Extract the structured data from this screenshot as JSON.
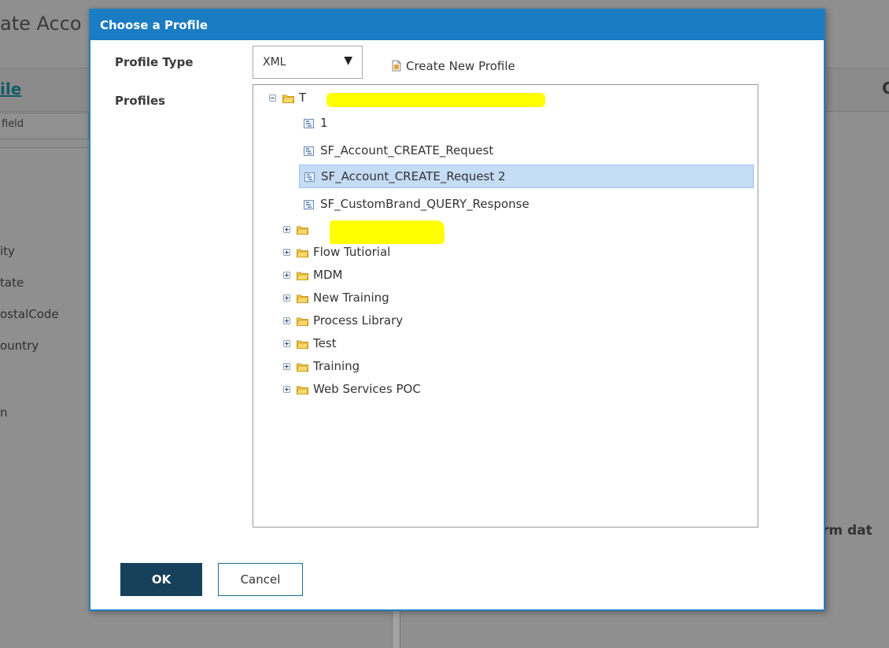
{
  "background": {
    "title_fragment": "ate Acco",
    "file_link": "ile",
    "field_placeholder": "field",
    "list_items": [
      "ity",
      "tate",
      "ostalCode",
      "ountry"
    ],
    "list_last": "n",
    "right_text": "rm dat",
    "right_dot": "."
  },
  "dialog": {
    "title": "Choose a Profile",
    "profile_type_label": "Profile Type",
    "profiles_label": "Profiles",
    "profile_type_value": "XML",
    "create_new_profile": "Create New Profile",
    "ok_label": "OK",
    "cancel_label": "Cancel"
  },
  "tree": {
    "root": {
      "label": "T",
      "expanded": true
    },
    "children": [
      {
        "label": "1",
        "selected": false
      },
      {
        "label": "SF_Account_CREATE_Request",
        "selected": false
      },
      {
        "label": "SF_Account_CREATE_Request 2",
        "selected": true
      },
      {
        "label": "SF_CustomBrand_QUERY_Response",
        "selected": false
      }
    ],
    "folders": [
      {
        "label": ""
      },
      {
        "label": "Flow Tutiorial"
      },
      {
        "label": "MDM"
      },
      {
        "label": "New Training"
      },
      {
        "label": "Process Library"
      },
      {
        "label": "Test"
      },
      {
        "label": "Training"
      },
      {
        "label": "Web Services POC"
      }
    ]
  },
  "colors": {
    "header": "#1a7cc2",
    "ok_button": "#17415a",
    "selection": "#c5dcf5",
    "highlight": "#ffff00"
  },
  "icons": {
    "folder": "folder-icon",
    "profile": "xml-profile-icon",
    "create": "new-profile-icon",
    "dropdown": "chevron-down-icon"
  }
}
